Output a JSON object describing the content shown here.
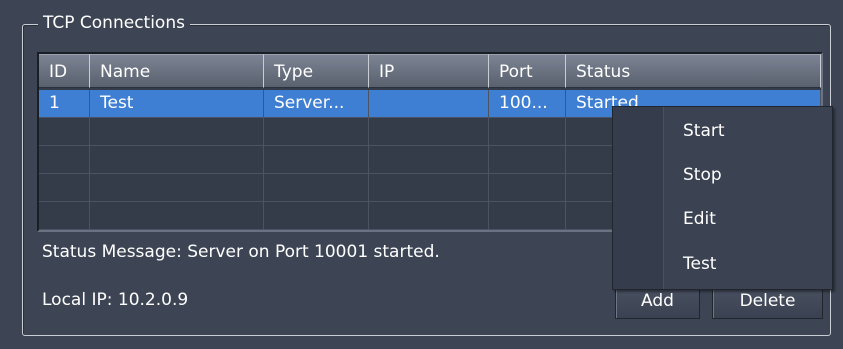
{
  "group": {
    "title": "TCP Connections"
  },
  "table": {
    "columns": [
      "ID",
      "Name",
      "Type",
      "IP",
      "Port",
      "Status"
    ],
    "rows": [
      [
        "1",
        "Test",
        "Server...",
        "",
        "100...",
        "Started"
      ],
      [
        "",
        "",
        "",
        "",
        "",
        ""
      ],
      [
        "",
        "",
        "",
        "",
        "",
        ""
      ],
      [
        "",
        "",
        "",
        "",
        "",
        ""
      ],
      [
        "",
        "",
        "",
        "",
        "",
        ""
      ]
    ]
  },
  "status": {
    "label": "Status Message:",
    "value": "Server on Port 10001 started."
  },
  "local_ip": {
    "label": "Local IP:",
    "value": "10.2.0.9"
  },
  "buttons": {
    "add": "Add",
    "delete": "Delete"
  },
  "context_menu": {
    "items": [
      "Start",
      "Stop",
      "Edit",
      "Test"
    ]
  },
  "colors": {
    "background": "#3d4555",
    "selection": "#3f7fd3",
    "header": "#6b7382"
  }
}
